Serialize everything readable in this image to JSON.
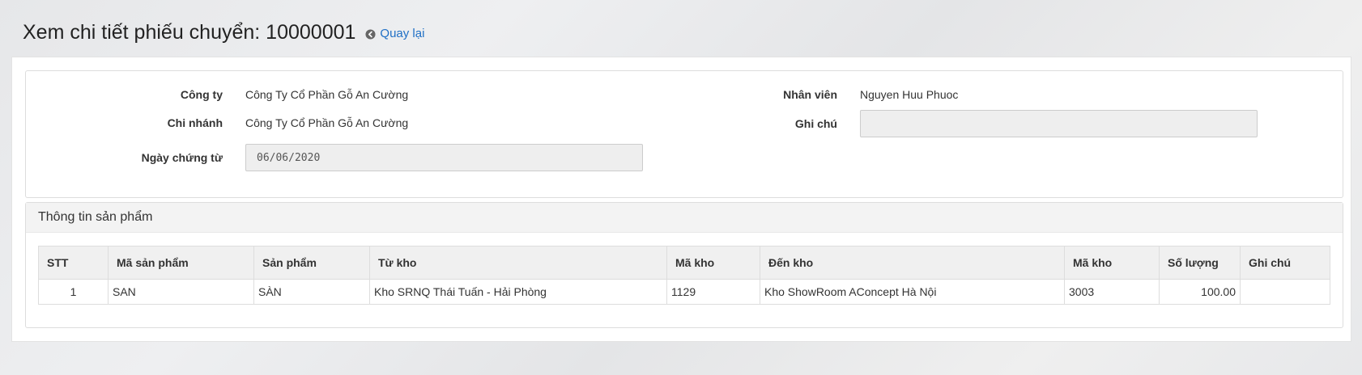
{
  "header": {
    "title": "Xem chi tiết phiếu chuyển: 10000001",
    "back_label": "Quay lại",
    "back_icon": "circle-arrow-left-icon"
  },
  "form": {
    "company_label": "Công ty",
    "company_value": "Công Ty Cổ Phần Gỗ An Cường",
    "branch_label": "Chi nhánh",
    "branch_value": "Công Ty Cổ Phần Gỗ An Cường",
    "date_label": "Ngày chứng từ",
    "date_value": "06/06/2020",
    "employee_label": "Nhân viên",
    "employee_value": "Nguyen Huu Phuoc",
    "note_label": "Ghi chú",
    "note_value": ""
  },
  "products": {
    "section_title": "Thông tin sản phẩm",
    "columns": [
      "STT",
      "Mã sản phẩm",
      "Sản phẩm",
      "Từ kho",
      "Mã kho",
      "Đến kho",
      "Mã kho",
      "Số lượng",
      "Ghi chú"
    ],
    "rows": [
      {
        "stt": "1",
        "product_code": "SAN",
        "product": "SÀN",
        "from_warehouse": "Kho SRNQ Thái Tuấn - Hải Phòng",
        "from_code": "1129",
        "to_warehouse": "Kho ShowRoom AConcept Hà Nội",
        "to_code": "3003",
        "quantity": "100.00",
        "note": ""
      }
    ]
  },
  "colors": {
    "link": "#1f6fc5",
    "panel_header_bg": "#f3f3f3",
    "readonly_field_bg": "#eeeeee"
  }
}
